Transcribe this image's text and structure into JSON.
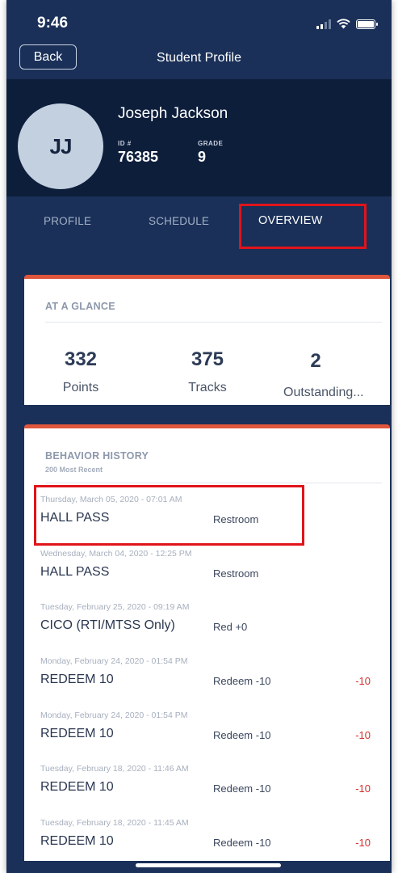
{
  "status_bar": {
    "time": "9:46"
  },
  "header": {
    "back_label": "Back",
    "title": "Student Profile"
  },
  "student": {
    "initials": "JJ",
    "name": "Joseph Jackson",
    "id_label": "ID #",
    "id_value": "76385",
    "grade_label": "GRADE",
    "grade_value": "9"
  },
  "tabs": [
    {
      "label": "PROFILE",
      "active": false
    },
    {
      "label": "SCHEDULE",
      "active": false
    },
    {
      "label": "OVERVIEW",
      "active": true
    }
  ],
  "at_a_glance": {
    "title": "AT A GLANCE",
    "stats": [
      {
        "value": "332",
        "label": "Points"
      },
      {
        "value": "375",
        "label": "Tracks"
      },
      {
        "value": "2",
        "label": "Outstanding..."
      }
    ]
  },
  "behavior_history": {
    "title": "BEHAVIOR HISTORY",
    "subtitle": "200 Most Recent",
    "entries": [
      {
        "date": "Thursday, March 05, 2020  -  07:01 AM",
        "type": "HALL PASS",
        "detail": "Restroom",
        "points": ""
      },
      {
        "date": "Wednesday, March 04, 2020  -  12:25 PM",
        "type": "HALL PASS",
        "detail": "Restroom",
        "points": ""
      },
      {
        "date": "Tuesday, February 25, 2020  -  09:19 AM",
        "type": "CICO (RTI/MTSS Only)",
        "detail": "Red +0",
        "points": ""
      },
      {
        "date": "Monday, February 24, 2020  -  01:54 PM",
        "type": "REDEEM 10",
        "detail": "Redeem -10",
        "points": "-10"
      },
      {
        "date": "Monday, February 24, 2020  -  01:54 PM",
        "type": "REDEEM 10",
        "detail": "Redeem -10",
        "points": "-10"
      },
      {
        "date": "Tuesday, February 18, 2020  -  11:46 AM",
        "type": "REDEEM 10",
        "detail": "Redeem -10",
        "points": "-10"
      },
      {
        "date": "Tuesday, February 18, 2020  -  11:45 AM",
        "type": "REDEEM 10",
        "detail": "Redeem -10",
        "points": "-10"
      }
    ]
  },
  "colors": {
    "background": "#1a3058",
    "profile_band": "#0d1e3b",
    "card_accent": "#e0563c",
    "highlight": "#e0141a",
    "negative_points": "#d3302b"
  },
  "icons": [
    "signal-icon",
    "wifi-icon",
    "battery-icon"
  ]
}
